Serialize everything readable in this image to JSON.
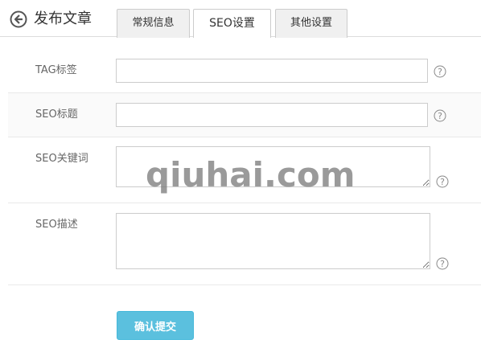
{
  "header": {
    "back_icon": "circle-arrow-left-icon",
    "title": "发布文章",
    "tabs": [
      {
        "label": "常规信息",
        "active": false
      },
      {
        "label": "SEO设置",
        "active": true
      },
      {
        "label": "其他设置",
        "active": false
      }
    ]
  },
  "form": {
    "rows": [
      {
        "label": "TAG标签",
        "value": "",
        "type": "input"
      },
      {
        "label": "SEO标题",
        "value": "",
        "type": "input"
      },
      {
        "label": "SEO关键词",
        "value": "",
        "type": "textarea"
      },
      {
        "label": "SEO描述",
        "value": "",
        "type": "textarea"
      }
    ],
    "help_icon": "question-circle-icon"
  },
  "watermark": "qiuhai.com",
  "submit_label": "确认提交",
  "colors": {
    "accent": "#5bc0de",
    "border": "#cccccc",
    "tab_bg": "#f0f0f0"
  }
}
